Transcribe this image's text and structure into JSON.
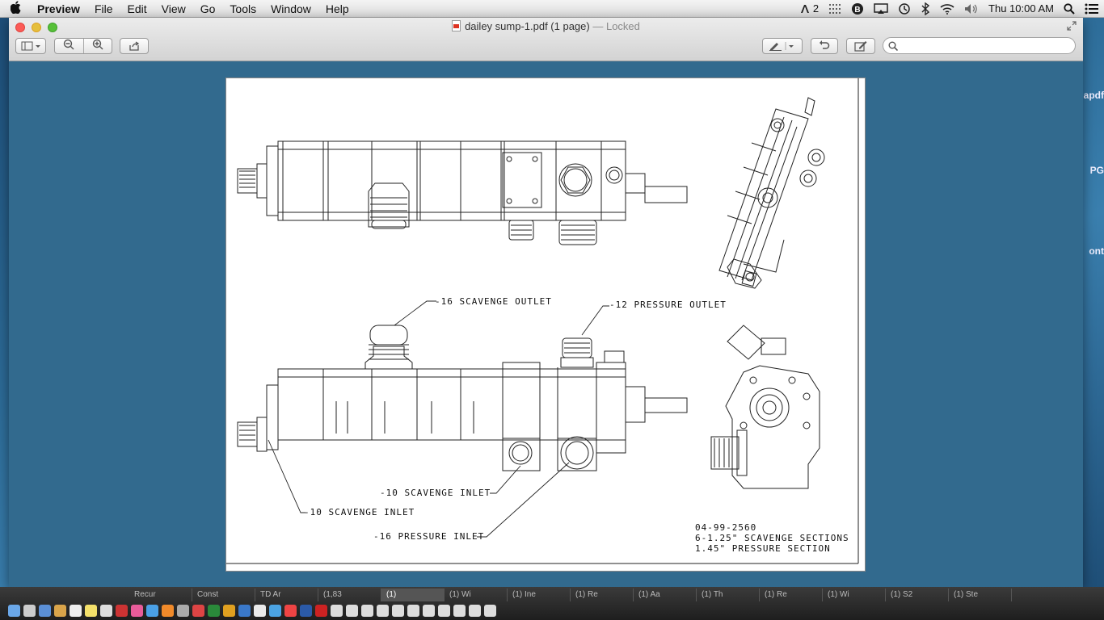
{
  "menubar": {
    "app_name": "Preview",
    "items": [
      "File",
      "Edit",
      "View",
      "Go",
      "Tools",
      "Window",
      "Help"
    ],
    "status": {
      "adobe_count": "2",
      "clock": "Thu 10:00 AM"
    }
  },
  "window": {
    "title": "dailey sump-1.pdf (1 page)",
    "title_suffix": "— Locked",
    "search_placeholder": ""
  },
  "drawing": {
    "labels": {
      "scavenge_outlet": "-16 SCAVENGE OUTLET",
      "pressure_outlet": "-12 PRESSURE OUTLET",
      "scavenge_inlet_10a": "-10 SCAVENGE INLET",
      "scavenge_inlet_10b": "-10 SCAVENGE INLET",
      "pressure_inlet": "-16 PRESSURE INLET"
    },
    "notes": {
      "part_number": "04-99-2560",
      "line1": "6-1.25\" SCAVENGE SECTIONS",
      "line2": "1.45\" PRESSURE SECTION"
    }
  },
  "desktop_peeks": {
    "item1": "apdf",
    "item2": "PG",
    "item3": "ont"
  },
  "dock": {
    "tabs": [
      "Recur",
      "Const",
      "TD Ar",
      "(1,83",
      "(1)",
      "(1) Wi",
      "(1) Ine",
      "(1) Re",
      "(1) Aa",
      "(1) Th",
      "(1) Re",
      "(1) Wi",
      "(1) S2",
      "(1) Ste"
    ]
  },
  "colors": {
    "window_background": "#326a8e",
    "page_background": "#ffffff"
  }
}
